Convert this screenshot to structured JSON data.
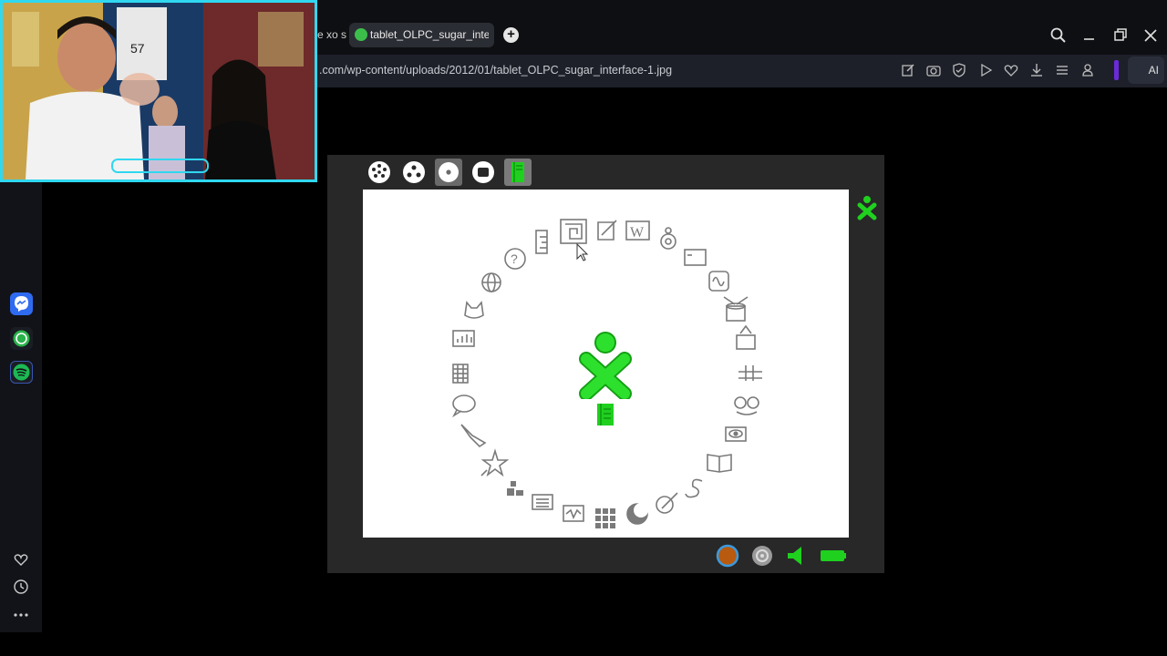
{
  "browser": {
    "tab_prev_label": "e xo su",
    "tab_active_label": "tablet_OLPC_sugar_interfa",
    "new_tab_symbol": "+",
    "url": ".com/wp-content/uploads/2012/01/tablet_OLPC_sugar_interface-1.jpg",
    "ai_button_label": "AI",
    "toolbar_icons": [
      "edit-icon",
      "camera-icon",
      "shield-icon",
      "play-icon",
      "heart-icon",
      "download-icon",
      "menu-icon",
      "user-icon"
    ],
    "window_controls": [
      "search-icon",
      "minimize-icon",
      "restore-icon",
      "close-icon"
    ]
  },
  "sidebar": {
    "apps": [
      "messenger-icon",
      "whatsapp-icon",
      "spotify-icon"
    ],
    "bottom_icons": [
      "heart-icon",
      "clock-icon",
      "more-icon"
    ],
    "colors": {
      "messenger": "#2f6bf0",
      "whatsapp": "#29b24a",
      "spotify": "#1db954"
    }
  },
  "webcam": {
    "border_color": "#2fd8f0",
    "jersey_number": "57"
  },
  "sugar": {
    "toolbar_views": [
      "neighborhood-view-icon",
      "group-view-icon",
      "home-view-icon",
      "activity-view-icon",
      "journal-view-icon"
    ],
    "xo_color": "#1fd01f",
    "activities": [
      "help-icon",
      "ruler-icon",
      "maze-icon",
      "write-icon",
      "wikipedia-icon",
      "turtle-icon",
      "terminal-icon",
      "measure-icon",
      "drum-icon",
      "music-icon",
      "tamtam-icon",
      "face-icon",
      "eye-icon",
      "read-icon",
      "snake-icon",
      "paint-icon",
      "moon-icon",
      "memorize-icon",
      "oscilloscope-icon",
      "list-icon",
      "blocks-icon",
      "star-icon",
      "bird-icon",
      "chat-icon",
      "calculator-icon",
      "chart-icon",
      "cat-icon",
      "browse-icon"
    ],
    "devices": [
      "xo-buddy-icon",
      "network-icon",
      "speaker-icon",
      "battery-icon"
    ]
  }
}
